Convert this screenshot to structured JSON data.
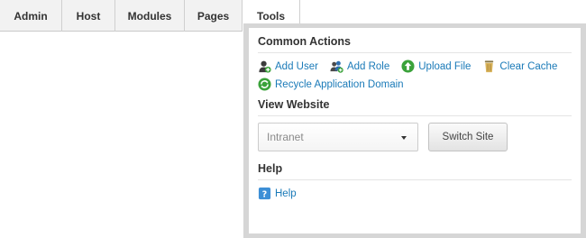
{
  "menubar": {
    "items": [
      {
        "label": "Admin"
      },
      {
        "label": "Host"
      },
      {
        "label": "Modules"
      },
      {
        "label": "Pages"
      },
      {
        "label": "Tools"
      }
    ]
  },
  "tools_menu": {
    "common_actions": {
      "title": "Common Actions",
      "actions": [
        {
          "label": "Add User",
          "icon": "add-user-icon"
        },
        {
          "label": "Add Role",
          "icon": "add-role-icon"
        },
        {
          "label": "Upload File",
          "icon": "upload-file-icon"
        },
        {
          "label": "Clear Cache",
          "icon": "clear-cache-icon"
        },
        {
          "label": "Recycle Application Domain",
          "icon": "recycle-icon"
        }
      ]
    },
    "view_website": {
      "title": "View Website",
      "selected_site": "Intranet",
      "switch_label": "Switch Site"
    },
    "help": {
      "title": "Help",
      "link_label": "Help",
      "icon": "help-icon"
    }
  },
  "colors": {
    "link": "#1a7ab8",
    "menubar_bg": "#f2f2f2",
    "panel_border": "#d6d6d6"
  }
}
